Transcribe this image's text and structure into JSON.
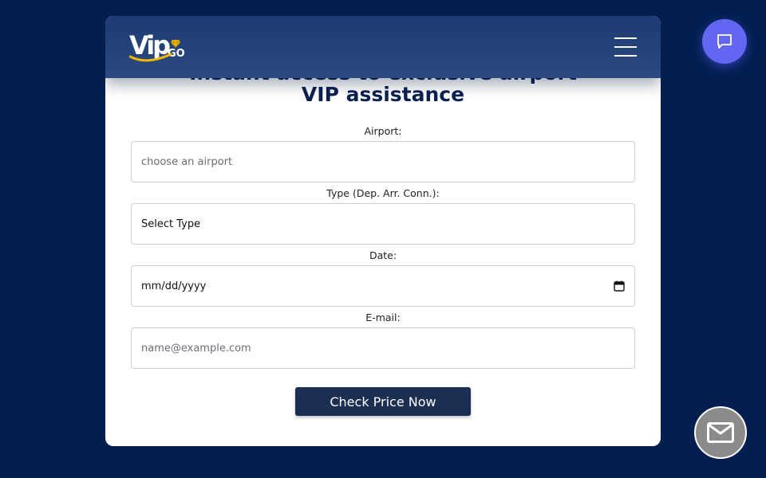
{
  "brand": {
    "logo_text": "Vip",
    "logo_suffix": "GO"
  },
  "form": {
    "heading_top": "Instant access to exclusive airport",
    "heading_bottom": "VIP assistance",
    "airport_label": "Airport:",
    "airport_placeholder": "choose an airport",
    "type_label": "Type (Dep. Arr. Conn.):",
    "type_value": "Select Type",
    "date_label": "Date:",
    "date_value": "mm/dd/yyyy",
    "email_label": "E-mail:",
    "email_placeholder": "name@example.com",
    "submit_label": "Check Price Now"
  },
  "icons": {
    "menu": "hamburger-menu-icon",
    "chat": "chat-bubble-icon",
    "mail": "envelope-icon",
    "calendar": "calendar-icon",
    "diamond": "diamond-icon"
  },
  "colors": {
    "background": "#031e4f",
    "header": "#1b3b72",
    "heading_text": "#0b2150",
    "button": "#1a2f52",
    "chat_button": "#6366f1",
    "mail_button": "#8b8b8b",
    "logo_accent": "#f2b705"
  }
}
